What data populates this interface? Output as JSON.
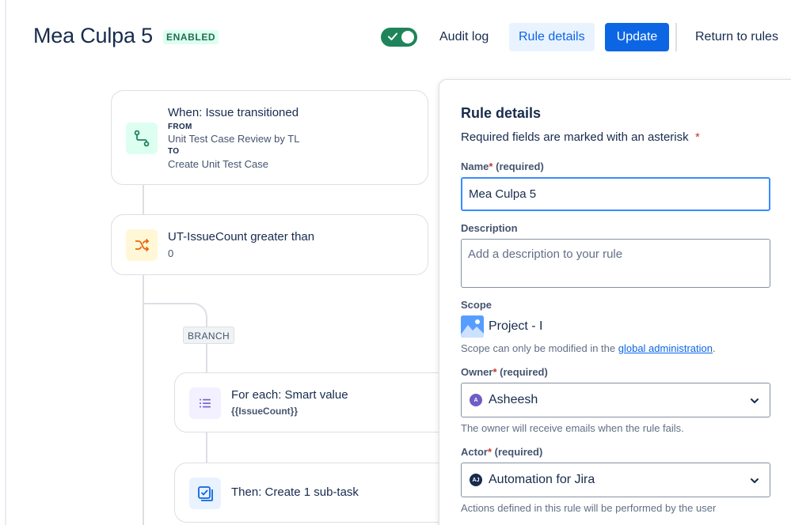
{
  "header": {
    "title": "Mea Culpa 5",
    "status": "ENABLED",
    "audit_log": "Audit log",
    "rule_details": "Rule details",
    "update": "Update",
    "return_to_rules": "Return to rules"
  },
  "flow": {
    "trigger": {
      "title": "When: Issue transitioned",
      "from_label": "FROM",
      "from_value": "Unit Test Case Review by TL",
      "to_label": "TO",
      "to_value": "Create Unit Test Case",
      "icon": "transition-icon"
    },
    "condition": {
      "title": "UT-IssueCount greater than",
      "value": "0",
      "icon": "shuffle-icon"
    },
    "branch_label": "BRANCH",
    "for_each": {
      "title": "For each: Smart value",
      "value": "{{IssueCount}}",
      "icon": "list-icon"
    },
    "action": {
      "title": "Then: Create 1 sub-task",
      "icon": "subtask-icon"
    }
  },
  "panel": {
    "title": "Rule details",
    "required_note": "Required fields are marked with an asterisk",
    "required_star": "*",
    "name_label": "Name",
    "name_star": "*",
    "name_required": "(required)",
    "name_value": "Mea Culpa 5",
    "description_label": "Description",
    "description_placeholder": "Add a description to your rule",
    "scope_label": "Scope",
    "scope_value": "Project - I",
    "scope_help_prefix": "Scope can only be modified in the ",
    "scope_help_link": "global administration",
    "scope_help_suffix": ".",
    "owner_label": "Owner",
    "owner_star": "*",
    "owner_required": "(required)",
    "owner_initial": "A",
    "owner_value": "Asheesh",
    "owner_help": "The owner will receive emails when the rule fails.",
    "actor_label": "Actor",
    "actor_star": "*",
    "actor_required": "(required)",
    "actor_initials": "AJ",
    "actor_value": "Automation for Jira",
    "actor_help": "Actions defined in this rule will be performed by the user"
  },
  "colors": {
    "primary": "#0c66e4",
    "toggle_on": "#1f845a",
    "badge_bg": "#dcfff1",
    "badge_text": "#216e4e",
    "required": "#c9372c",
    "owner_avatar": "#6e5dc6",
    "actor_avatar": "#172b4d"
  }
}
